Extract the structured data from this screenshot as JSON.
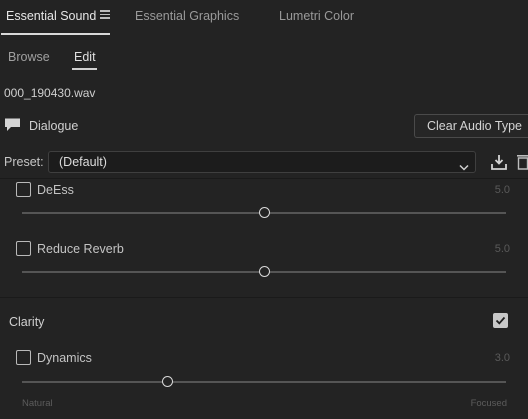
{
  "panel_tabs": {
    "essential_sound": "Essential Sound",
    "essential_graphics": "Essential Graphics",
    "lumetri_color": "Lumetri Color"
  },
  "sub_tabs": {
    "browse": "Browse",
    "edit": "Edit"
  },
  "clip": {
    "filename": "000_190430.wav"
  },
  "audio_type": {
    "label": "Dialogue",
    "clear_button": "Clear Audio Type"
  },
  "preset": {
    "label": "Preset:",
    "value": "(Default)"
  },
  "options": {
    "deess": {
      "label": "DeEss",
      "value": "5.0",
      "checked": false,
      "level": 0.5
    },
    "reduce_reverb": {
      "label": "Reduce Reverb",
      "value": "5.0",
      "checked": false,
      "level": 0.5
    }
  },
  "clarity": {
    "label": "Clarity",
    "checked": true,
    "dynamics": {
      "label": "Dynamics",
      "value": "3.0",
      "checked": false,
      "level": 0.3,
      "min_label": "Natural",
      "max_label": "Focused"
    }
  },
  "colors": {
    "background": "#232323",
    "track": "#555555",
    "text": "#c8c8c8"
  }
}
